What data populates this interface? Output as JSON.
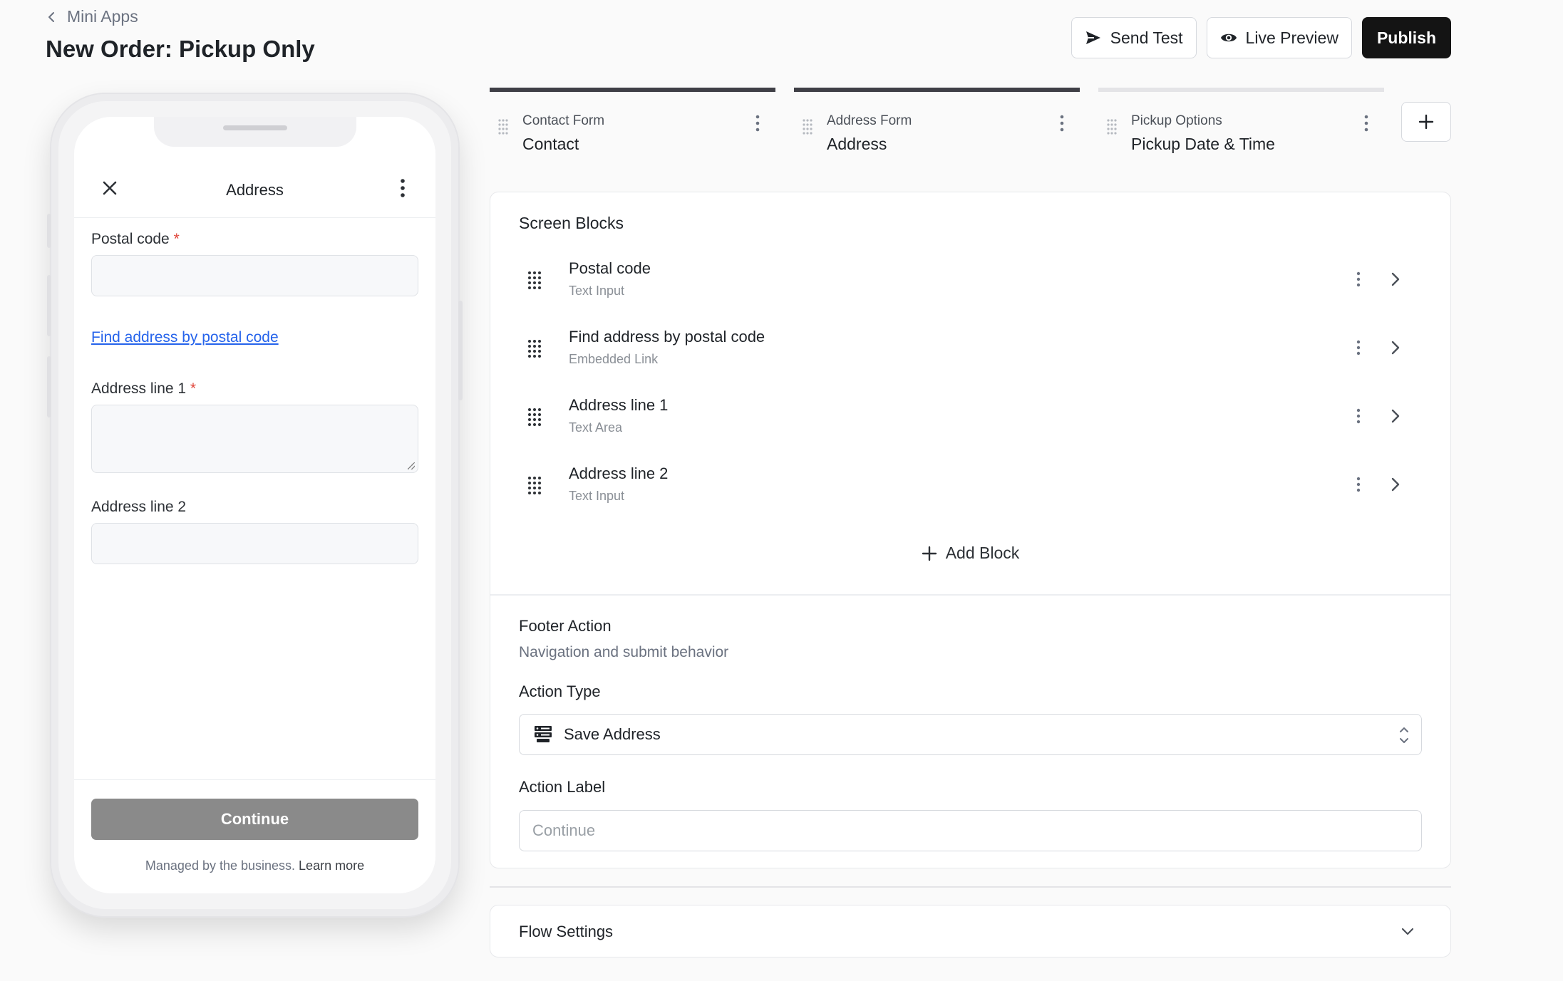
{
  "header": {
    "breadcrumb": "Mini Apps",
    "title": "New Order: Pickup Only",
    "send_test": "Send Test",
    "live_preview": "Live Preview",
    "publish": "Publish"
  },
  "phone": {
    "screen_title": "Address",
    "fields": {
      "postal_code_label": "Postal code",
      "required_mark": "*",
      "find_link": "Find address by postal code",
      "address1_label": "Address line 1",
      "address2_label": "Address line 2"
    },
    "continue_label": "Continue",
    "footer_note": "Managed by the business.",
    "learn_more": "Learn more"
  },
  "tabs": [
    {
      "kicker": "Contact Form",
      "name": "Contact",
      "state": "done"
    },
    {
      "kicker": "Address Form",
      "name": "Address",
      "state": "active"
    },
    {
      "kicker": "Pickup Options",
      "name": "Pickup Date & Time",
      "state": "pending"
    }
  ],
  "blocks_section": {
    "title": "Screen Blocks",
    "blocks": [
      {
        "name": "Postal code",
        "type": "Text Input"
      },
      {
        "name": "Find address by postal code",
        "type": "Embedded Link"
      },
      {
        "name": "Address line 1",
        "type": "Text Area"
      },
      {
        "name": "Address line 2",
        "type": "Text Input"
      }
    ],
    "add_block": "Add Block"
  },
  "footer_action": {
    "title": "Footer Action",
    "subtitle": "Navigation and submit behavior",
    "action_type_label": "Action Type",
    "action_type_value": "Save Address",
    "action_label_label": "Action Label",
    "action_label_placeholder": "Continue"
  },
  "flow_settings": {
    "title": "Flow Settings"
  },
  "colors": {
    "accent_dark": "#141414",
    "link": "#2563eb",
    "required": "#e0453a",
    "disabled_button": "#8a8a8a"
  },
  "icons": {
    "back": "chevron-left-icon",
    "send": "paper-plane-icon",
    "preview": "eye-icon",
    "close": "close-icon",
    "more": "more-vertical-icon",
    "drag": "drag-handle-icon",
    "arrow": "chevron-right-icon",
    "add": "plus-icon",
    "server": "server-icon",
    "select": "chevron-up-down-icon",
    "expand": "chevron-down-icon"
  }
}
